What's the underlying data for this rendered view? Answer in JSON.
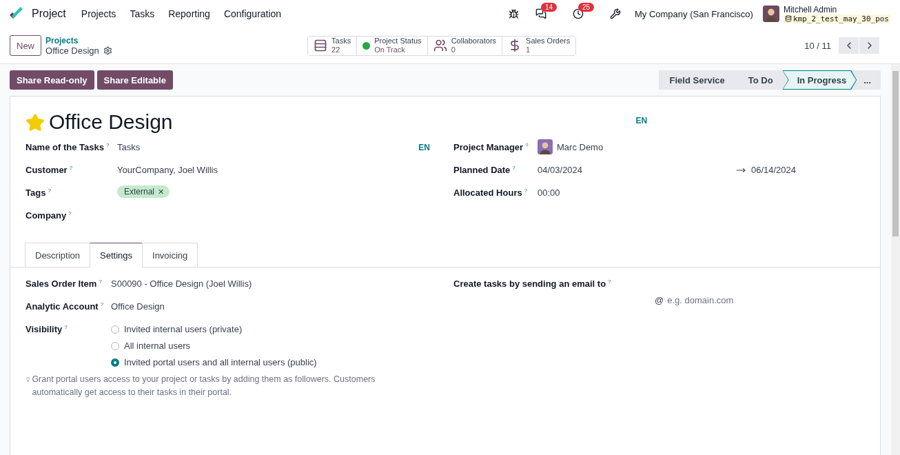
{
  "navbar": {
    "app_name": "Project",
    "menu": [
      "Projects",
      "Tasks",
      "Reporting",
      "Configuration"
    ],
    "chat_count": "14",
    "activity_count": "25",
    "company": "My Company (San Francisco)",
    "user": {
      "name": "Mitchell Admin",
      "database": "kmp_2_test_may_30_pos"
    }
  },
  "control_panel": {
    "new_button": "New",
    "breadcrumb": {
      "parent": "Projects",
      "current": "Office Design"
    },
    "smart_buttons": [
      {
        "kind": "tasks",
        "label": "Tasks",
        "value": "22"
      },
      {
        "kind": "status",
        "label": "Project Status",
        "value": "On Track",
        "color": "#28a745"
      },
      {
        "kind": "collaborators",
        "label": "Collaborators",
        "value": "0"
      },
      {
        "kind": "sales",
        "label": "Sales Orders",
        "value": "1"
      }
    ],
    "pager": "10 / 11"
  },
  "actions": [
    "Share Read-only",
    "Share Editable"
  ],
  "stages": [
    {
      "label": "Field Service",
      "selected": false
    },
    {
      "label": "To Do",
      "selected": false
    },
    {
      "label": "In Progress",
      "selected": true
    }
  ],
  "stage_more": "...",
  "sheet": {
    "favorite": true,
    "title": "Office Design",
    "title_lang": "EN",
    "left_fields": [
      {
        "kind": "text",
        "label": "Name of the Tasks",
        "help": "?",
        "value": "Tasks",
        "lang": "EN"
      },
      {
        "kind": "text",
        "label": "Customer",
        "help": "?",
        "value": "YourCompany, Joel Willis"
      },
      {
        "kind": "tags",
        "label": "Tags",
        "help": "?",
        "tags": [
          {
            "label": "External",
            "remove": "✕",
            "color": "#c3eacb"
          }
        ]
      },
      {
        "kind": "text",
        "label": "Company",
        "help": "?"
      }
    ],
    "right_fields": [
      {
        "kind": "avatar",
        "label": "Project Manager",
        "help": "?",
        "value": "Marc Demo"
      },
      {
        "kind": "daterange",
        "label": "Planned Date",
        "help": "?",
        "value": "04/03/2024",
        "end": "06/14/2024"
      },
      {
        "kind": "text",
        "label": "Allocated Hours",
        "help": "?",
        "value": "00:00"
      }
    ],
    "tabs": [
      {
        "label": "Description",
        "selected": false
      },
      {
        "label": "Settings",
        "selected": true
      },
      {
        "label": "Invoicing",
        "selected": false
      }
    ],
    "settings": {
      "left_fields": [
        {
          "kind": "text",
          "label": "Sales Order Item",
          "help": "?",
          "value": "S00090 - Office Design (Joel Willis)"
        },
        {
          "kind": "text",
          "label": "Analytic Account",
          "help": "?",
          "value": "Office Design"
        },
        {
          "kind": "radio",
          "label": "Visibility",
          "help": "?",
          "options": [
            {
              "label": "Invited internal users (private)",
              "selected": false
            },
            {
              "label": "All internal users",
              "selected": false
            },
            {
              "label": "Invited portal users and all internal users (public)",
              "selected": true
            }
          ]
        }
      ],
      "hint": "Grant portal users access to your project or tasks by adding them as followers. Customers automatically get access to their tasks in their portal.",
      "email": {
        "label": "Create tasks by sending an email to",
        "help": "?",
        "at": "@",
        "placeholder": "e.g. domain.com"
      }
    }
  }
}
